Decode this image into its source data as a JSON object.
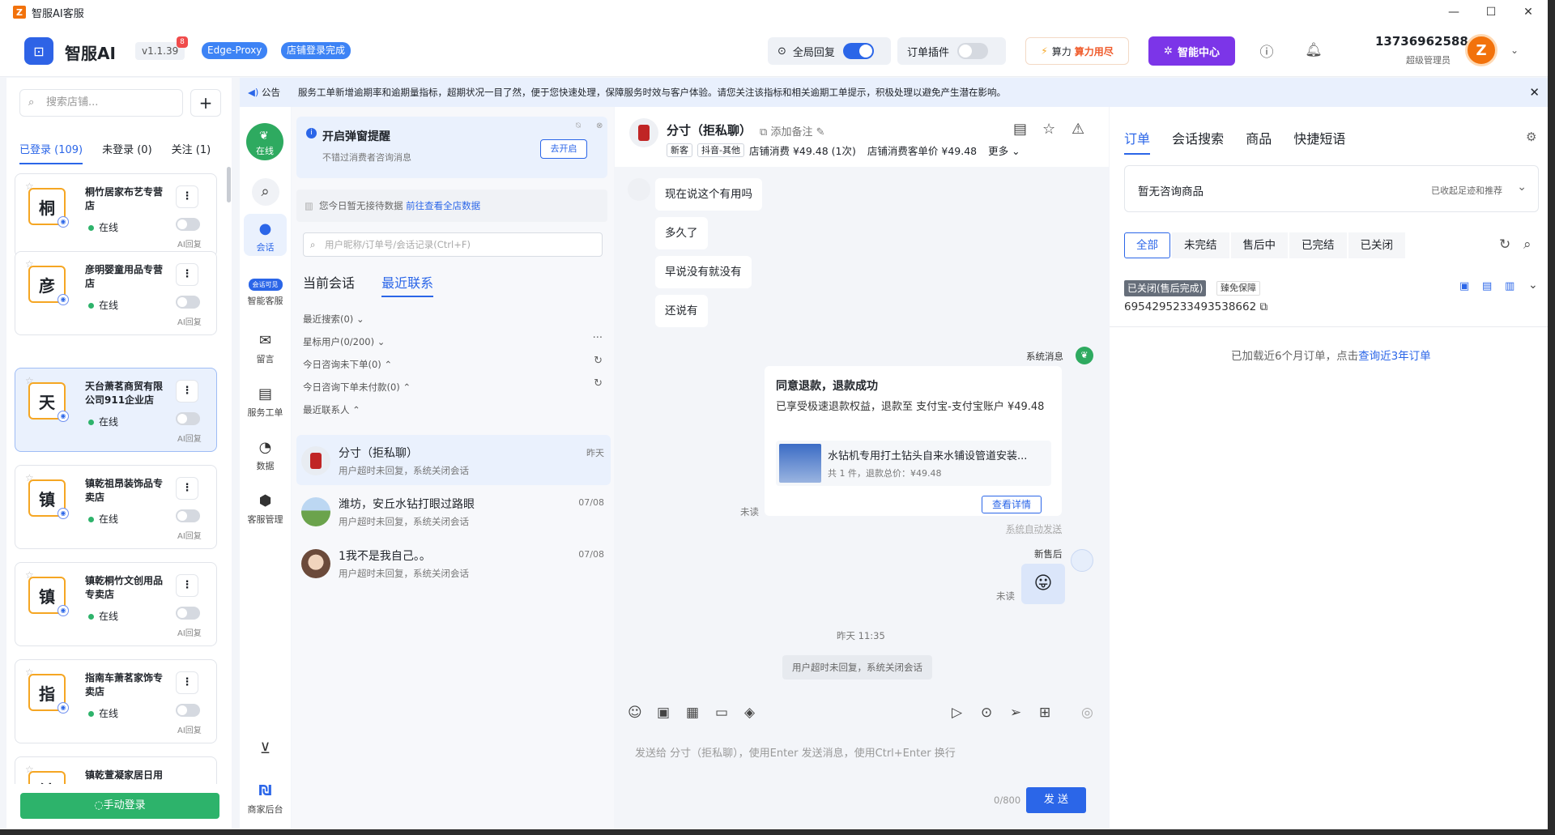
{
  "window": {
    "title": "智服AI客服",
    "logo_letter": "Z",
    "minimize": "—",
    "maximize": "☐",
    "close": "✕"
  },
  "header": {
    "brand": "智服AI",
    "version": "v1.1.39",
    "version_badge": "8",
    "proxy": "Edge-Proxy",
    "login_status": "店铺登录完成",
    "global_reply": "全局回复",
    "order_plugin": "订单插件",
    "power_label": "算力",
    "power_status": "算力用尽",
    "smart_center": "智能中心",
    "phone": "13736962588",
    "role": "超级管理员",
    "avatar_letter": "Z"
  },
  "sidebar": {
    "search_placeholder": "搜索店铺...",
    "add": "+",
    "tabs": [
      {
        "label": "已登录 (109)"
      },
      {
        "label": "未登录 (0)"
      },
      {
        "label": "关注 (1)"
      }
    ],
    "shops": [
      {
        "logo": "桐",
        "name": "桐竹居家布艺专营店",
        "status": "在线",
        "ai": "AI回复"
      },
      {
        "logo": "彦",
        "name": "彦明婴童用品专营店",
        "status": "在线",
        "ai": "AI回复"
      },
      {
        "logo": "天",
        "name": "天台萧茗商贸有限公司911企业店",
        "status": "在线",
        "ai": "AI回复"
      },
      {
        "logo": "镇",
        "name": "镇乾祖昂装饰品专卖店",
        "status": "在线",
        "ai": "AI回复"
      },
      {
        "logo": "镇",
        "name": "镇乾桐竹文创用品专卖店",
        "status": "在线",
        "ai": "AI回复"
      },
      {
        "logo": "指",
        "name": "指南车萧茗家饰专卖店",
        "status": "在线",
        "ai": "AI回复"
      },
      {
        "logo": "镇",
        "name": "镇乾萱凝家居日用",
        "status": "",
        "ai": ""
      }
    ],
    "manual_login": "◌手动登录"
  },
  "notice": {
    "label": "公告",
    "text": "服务工单新增逾期率和逾期量指标，超期状况一目了然，便于您快速处理，保障服务时效与客户体验。请您关注该指标和相关逾期工单提示，积极处理以避免产生潜在影响。"
  },
  "nav": {
    "online": "在线",
    "items": [
      {
        "label": "会话",
        "icon": "chat-icon"
      },
      {
        "label": "智能客服",
        "badge": "会话可见"
      },
      {
        "label": "留言",
        "icon": "mail-icon"
      },
      {
        "label": "服务工单",
        "icon": "ticket-icon"
      },
      {
        "label": "数据",
        "icon": "pie-icon"
      },
      {
        "label": "客服管理",
        "icon": "shield-icon"
      }
    ],
    "merchant": "商家后台"
  },
  "conversations": {
    "reminder_title": "开启弹窗提醒",
    "reminder_sub": "不错过消费者咨询消息",
    "reminder_btn": "去开启",
    "nodata_text": "您今日暂无接待数据",
    "nodata_link": "前往查看全店数据",
    "search_placeholder": "用户昵称/订单号/会话记录(Ctrl+F)",
    "tabs": [
      {
        "label": "当前会话"
      },
      {
        "label": "最近联系"
      }
    ],
    "groups": [
      {
        "label": "最近搜索(0)"
      },
      {
        "label": "星标用户(0/200)"
      },
      {
        "label": "今日咨询未下单(0)"
      },
      {
        "label": "今日咨询下单未付款(0)"
      },
      {
        "label": "最近联系人"
      }
    ],
    "more": "···",
    "refresh": "↻",
    "items": [
      {
        "name": "分寸（拒私聊）",
        "msg": "用户超时未回复，系统关闭会话",
        "date": "昨天"
      },
      {
        "name": "潍坊，安丘水钻打眼过路眼",
        "msg": "用户超时未回复，系统关闭会话",
        "date": "07/08"
      },
      {
        "name": "1我不是我自己。。",
        "msg": "用户超时未回复，系统关闭会话",
        "date": "07/08"
      }
    ]
  },
  "chat": {
    "name": "分寸（拒私聊）",
    "add_note": "添加备注",
    "tags": [
      "新客",
      "抖音-其他"
    ],
    "spend": "店铺消费 ¥49.48 (1次)",
    "avg": "店铺消费客单价 ¥49.48",
    "more": "更多",
    "messages": [
      "现在说这个有用吗",
      "多久了",
      "早说没有就没有",
      "还说有"
    ],
    "system_label": "系统消息",
    "card_title": "同意退款，退款成功",
    "card_desc": "已享受极速退款权益，退款至 支付宝-支付宝账户 ¥49.48",
    "product_name": "水钻机专用打土钻头自来水铺设管道安装...",
    "product_count": "共 1 件，退款总价：¥49.48",
    "card_btn": "查看详情",
    "unread": "未读",
    "auto_sent": "系统自动发送",
    "agent_label": "新售后",
    "emoji": "😛",
    "time": "昨天 11:35",
    "closed": "用户超时未回复，系统关闭会话",
    "input_placeholder": "发送给 分寸（拒私聊），使用Enter 发送消息，使用Ctrl+Enter 换行",
    "counter": "0/800",
    "send": "发 送"
  },
  "right": {
    "tabs": [
      {
        "label": "订单"
      },
      {
        "label": "会话搜索"
      },
      {
        "label": "商品"
      },
      {
        "label": "快捷短语"
      }
    ],
    "no_product": "暂无咨询商品",
    "collected": "已收起足迹和推荐",
    "filters": [
      {
        "label": "全部"
      },
      {
        "label": "未完结"
      },
      {
        "label": "售后中"
      },
      {
        "label": "已完结"
      },
      {
        "label": "已关闭"
      }
    ],
    "order_status": "已关闭(售后完成)",
    "order_tag": "臻免保障",
    "order_no": "6954295233493538662",
    "loaded_text": "已加载近6个月订单，点击",
    "loaded_link": "查询近3年订单"
  }
}
